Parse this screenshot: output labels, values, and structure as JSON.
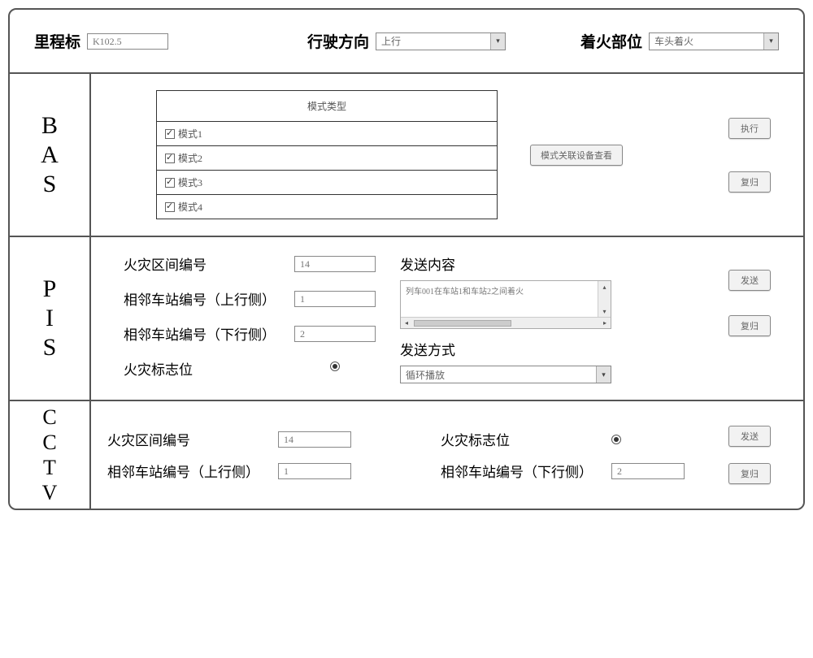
{
  "top": {
    "mileage_label": "里程标",
    "mileage_value": "K102.5",
    "direction_label": "行驶方向",
    "direction_value": "上行",
    "fire_pos_label": "着火部位",
    "fire_pos_value": "车头着火"
  },
  "bas": {
    "label_line1": "B",
    "label_line2": "A",
    "label_line3": "S",
    "header": "模式类型",
    "modes": {
      "m1": "模式1",
      "m2": "模式2",
      "m3": "模式3",
      "m4": "模式4"
    },
    "assoc_btn": "模式关联设备查看",
    "exec_btn": "执行",
    "reset_btn": "复归"
  },
  "pis": {
    "label_line1": "P",
    "label_line2": "I",
    "label_line3": "S",
    "zone_label": "火灾区间编号",
    "zone_value": "14",
    "up_label": "相邻车站编号（上行侧）",
    "up_value": "1",
    "down_label": "相邻车站编号（下行侧）",
    "down_value": "2",
    "flag_label": "火灾标志位",
    "content_label": "发送内容",
    "content_text": "列车001在车站1和车站2之间着火",
    "method_label": "发送方式",
    "method_value": "循环播放",
    "send_btn": "发送",
    "reset_btn": "复归"
  },
  "cctv": {
    "label_line1": "C",
    "label_line2": "C",
    "label_line3": "T",
    "label_line4": "V",
    "zone_label": "火灾区间编号",
    "zone_value": "14",
    "flag_label": "火灾标志位",
    "up_label": "相邻车站编号（上行侧）",
    "up_value": "1",
    "down_label": "相邻车站编号（下行侧）",
    "down_value": "2",
    "send_btn": "发送",
    "reset_btn": "复归"
  }
}
